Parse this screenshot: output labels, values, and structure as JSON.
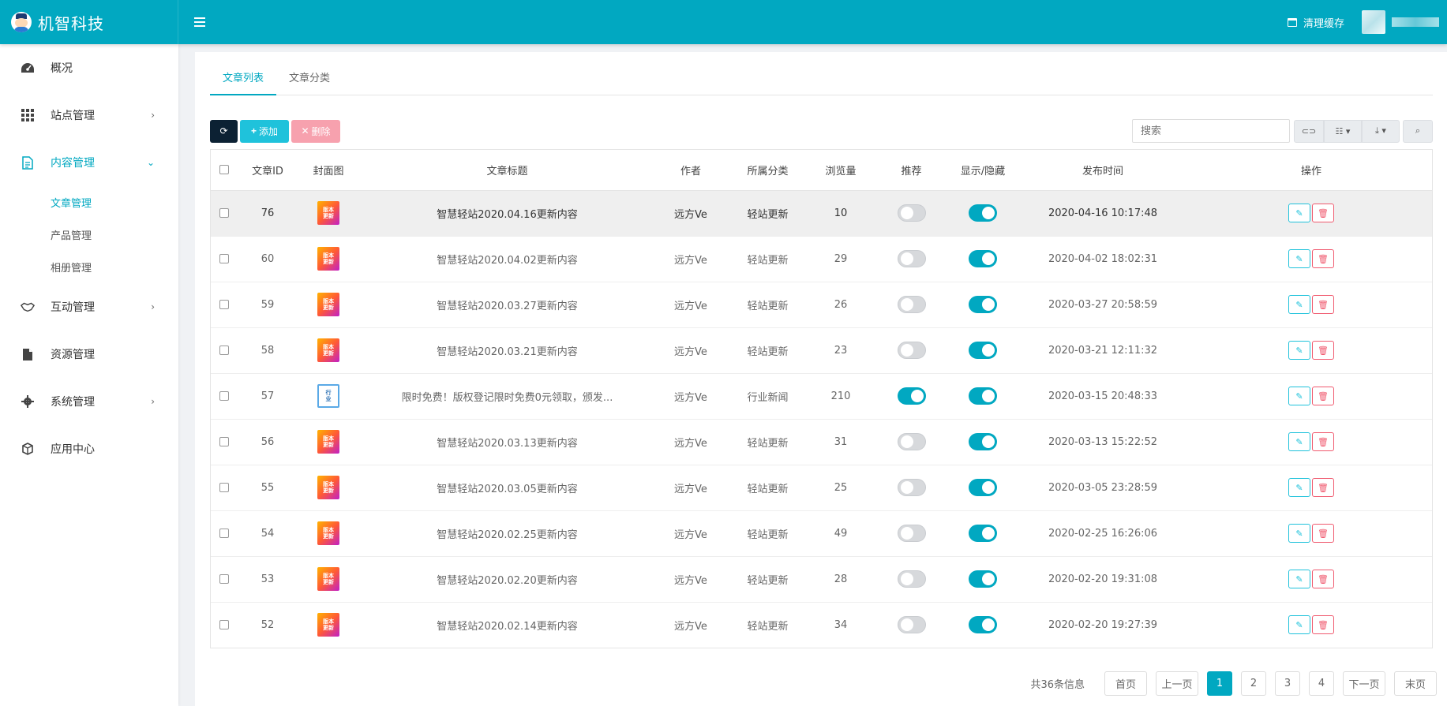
{
  "brand": {
    "name": "机智科技"
  },
  "header": {
    "clear_cache": "清理缓存"
  },
  "sidebar": {
    "items": [
      {
        "label": "概况",
        "icon": "dashboard-icon"
      },
      {
        "label": "站点管理",
        "icon": "grid-icon"
      },
      {
        "label": "内容管理",
        "icon": "document-icon"
      },
      {
        "label": "互动管理",
        "icon": "handshake-icon"
      },
      {
        "label": "资源管理",
        "icon": "file-icon"
      },
      {
        "label": "系统管理",
        "icon": "gear-icon"
      },
      {
        "label": "应用中心",
        "icon": "cube-icon"
      }
    ],
    "sub_items": [
      {
        "label": "文章管理"
      },
      {
        "label": "产品管理"
      },
      {
        "label": "相册管理"
      }
    ]
  },
  "tabs": [
    {
      "label": "文章列表"
    },
    {
      "label": "文章分类"
    }
  ],
  "toolbar": {
    "add_label": "添加",
    "delete_label": "删除",
    "search_placeholder": "搜索"
  },
  "table": {
    "headers": [
      "文章ID",
      "封面图",
      "文章标题",
      "作者",
      "所属分类",
      "浏览量",
      "推荐",
      "显示/隐藏",
      "发布时间",
      "操作"
    ],
    "rows": [
      {
        "id": "76",
        "cover": "版本更新",
        "title": "智慧轻站2020.04.16更新内容",
        "author": "远方Ve",
        "category": "轻站更新",
        "views": "10",
        "recommend": false,
        "visible": true,
        "time": "2020-04-16 10:17:48"
      },
      {
        "id": "60",
        "cover": "版本更新",
        "title": "智慧轻站2020.04.02更新内容",
        "author": "远方Ve",
        "category": "轻站更新",
        "views": "29",
        "recommend": false,
        "visible": true,
        "time": "2020-04-02 18:02:31"
      },
      {
        "id": "59",
        "cover": "版本更新",
        "title": "智慧轻站2020.03.27更新内容",
        "author": "远方Ve",
        "category": "轻站更新",
        "views": "26",
        "recommend": false,
        "visible": true,
        "time": "2020-03-27 20:58:59"
      },
      {
        "id": "58",
        "cover": "版本更新",
        "title": "智慧轻站2020.03.21更新内容",
        "author": "远方Ve",
        "category": "轻站更新",
        "views": "23",
        "recommend": false,
        "visible": true,
        "time": "2020-03-21 12:11:32"
      },
      {
        "id": "57",
        "cover": "行业",
        "title": "限时免费！版权登记限时免费0元领取，颁发...",
        "author": "远方Ve",
        "category": "行业新闻",
        "views": "210",
        "recommend": true,
        "visible": true,
        "time": "2020-03-15 20:48:33"
      },
      {
        "id": "56",
        "cover": "版本更新",
        "title": "智慧轻站2020.03.13更新内容",
        "author": "远方Ve",
        "category": "轻站更新",
        "views": "31",
        "recommend": false,
        "visible": true,
        "time": "2020-03-13 15:22:52"
      },
      {
        "id": "55",
        "cover": "版本更新",
        "title": "智慧轻站2020.03.05更新内容",
        "author": "远方Ve",
        "category": "轻站更新",
        "views": "25",
        "recommend": false,
        "visible": true,
        "time": "2020-03-05 23:28:59"
      },
      {
        "id": "54",
        "cover": "版本更新",
        "title": "智慧轻站2020.02.25更新内容",
        "author": "远方Ve",
        "category": "轻站更新",
        "views": "49",
        "recommend": false,
        "visible": true,
        "time": "2020-02-25 16:26:06"
      },
      {
        "id": "53",
        "cover": "版本更新",
        "title": "智慧轻站2020.02.20更新内容",
        "author": "远方Ve",
        "category": "轻站更新",
        "views": "28",
        "recommend": false,
        "visible": true,
        "time": "2020-02-20 19:31:08"
      },
      {
        "id": "52",
        "cover": "版本更新",
        "title": "智慧轻站2020.02.14更新内容",
        "author": "远方Ve",
        "category": "轻站更新",
        "views": "34",
        "recommend": false,
        "visible": true,
        "time": "2020-02-20 19:27:39"
      }
    ]
  },
  "pagination": {
    "info": "共36条信息",
    "first": "首页",
    "prev": "上一页",
    "next": "下一页",
    "last": "末页",
    "pages": [
      "1",
      "2",
      "3",
      "4"
    ],
    "current": "1"
  },
  "colors": {
    "accent": "#01a8c1",
    "danger": "#f05a6f",
    "dark": "#0c2133"
  }
}
